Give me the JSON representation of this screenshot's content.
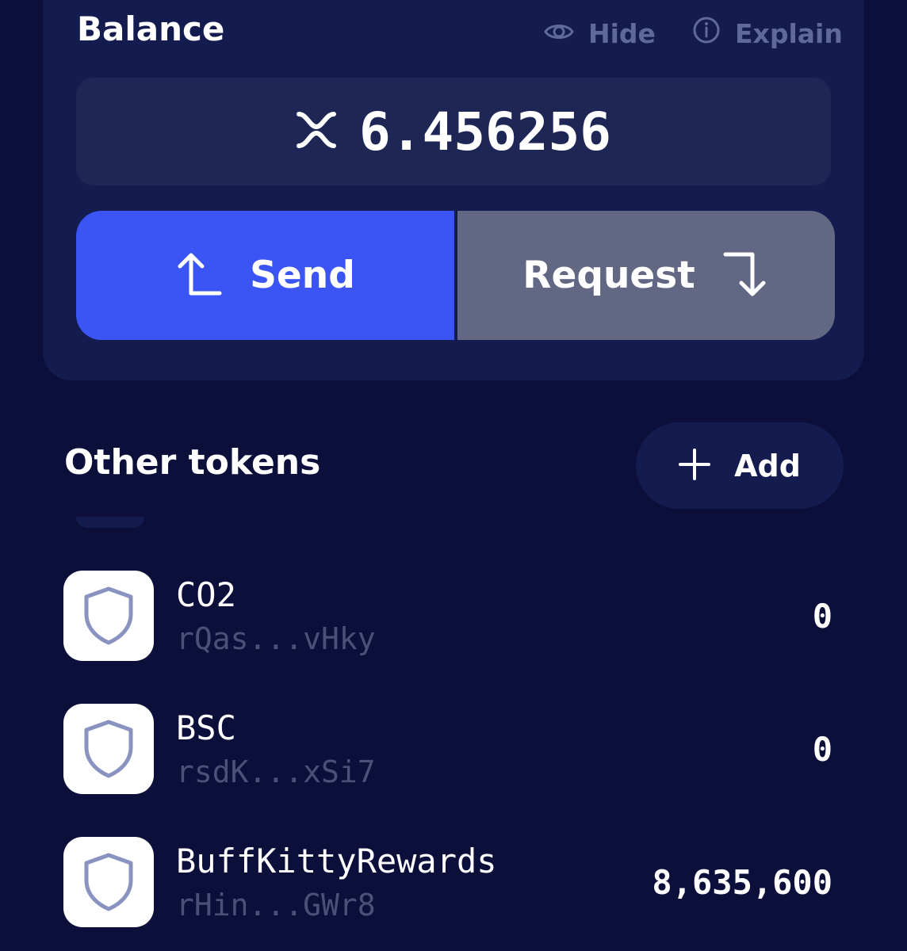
{
  "balance": {
    "title": "Balance",
    "hide_label": "Hide",
    "explain_label": "Explain",
    "amount": "6.456256",
    "currency_icon": "xrp-icon"
  },
  "actions": {
    "send_label": "Send",
    "request_label": "Request"
  },
  "tokens_section": {
    "title": "Other tokens",
    "add_label": "Add",
    "items": [
      {
        "name": "CO2",
        "address": "rQas...vHky",
        "balance": "0",
        "icon": "shield-icon"
      },
      {
        "name": "BSC",
        "address": "rsdK...xSi7",
        "balance": "0",
        "icon": "shield-icon"
      },
      {
        "name": "BuffKittyRewards",
        "address": "rHin...GWr8",
        "balance": "8,635,600",
        "icon": "shield-icon"
      }
    ]
  },
  "colors": {
    "background": "#0b0f3a",
    "card": "#141b4e",
    "send_button": "#3a55f3",
    "request_button": "#626884",
    "muted_text": "#5f6a9b"
  }
}
